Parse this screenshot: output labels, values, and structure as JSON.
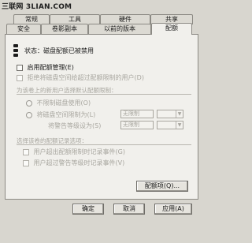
{
  "watermark": "三联网 3LIAN.COM",
  "tabs_row1": [
    "常规",
    "工具",
    "硬件",
    "共享"
  ],
  "tabs_row2": [
    "安全",
    "卷影副本",
    "以前的版本",
    "配额"
  ],
  "status": {
    "label": "状态：",
    "value": "磁盘配额已被禁用"
  },
  "enable_quota": "启用配额管理(E)",
  "deny_space": "拒绝将磁盘空间给超过配额限制的用户(D)",
  "defaults_group": "为该卷上的新用户选择默认配额限制：",
  "no_limit": "不限制磁盘使用(O)",
  "limit_space": "将磁盘空间限制为(L)",
  "warning_level": "将警告等级设为(S)",
  "unlimited": "无限制",
  "log_group": "选择该卷的配额记录选项：",
  "log_over_limit": "用户超出配额限制时记录事件(G)",
  "log_over_warning": "用户超过警告等级时记录事件(V)",
  "quota_entries_button": "配额项(Q)...",
  "ok_button": "确定",
  "cancel_button": "取消",
  "apply_button": "应用(A)"
}
